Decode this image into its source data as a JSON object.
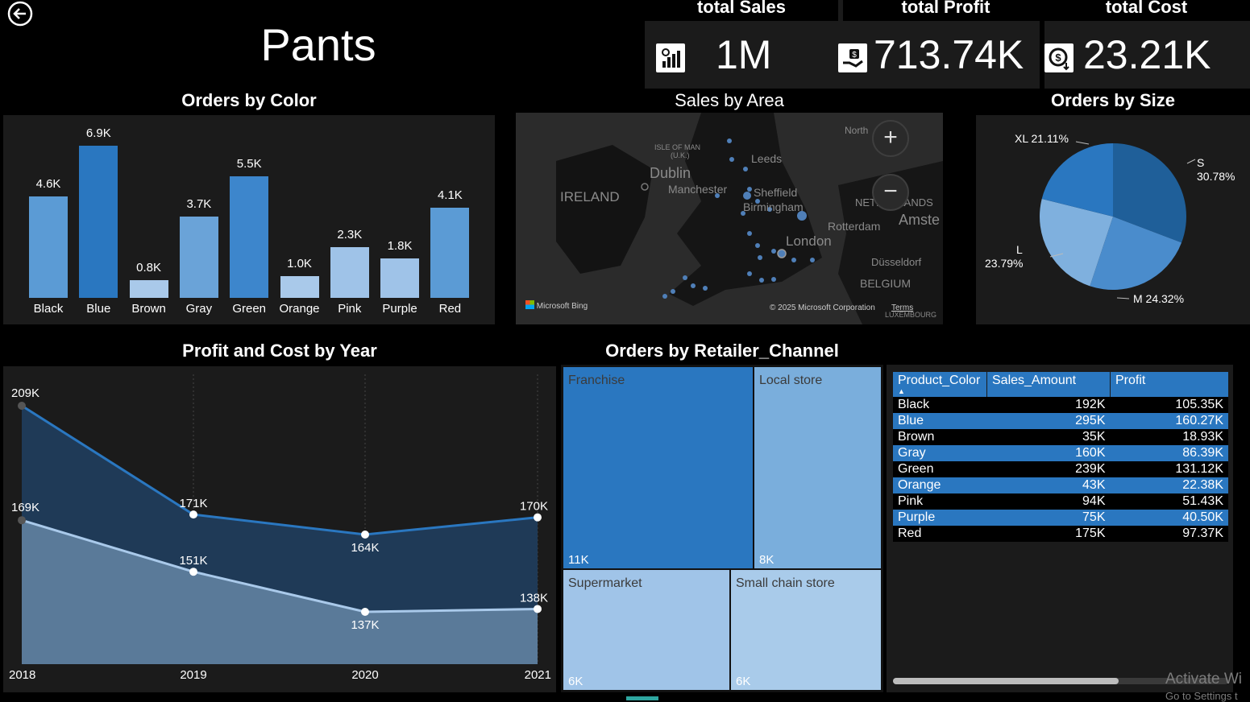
{
  "page": {
    "title": "Pants",
    "back_icon": "back-arrow-icon"
  },
  "kpis": [
    {
      "label": "total Sales",
      "value": "1M",
      "icon": "bar-chart-dollar-icon"
    },
    {
      "label": "total Profit",
      "value": "713.74K",
      "icon": "hand-money-icon"
    },
    {
      "label": "total Cost",
      "value": "23.21K",
      "icon": "dollar-down-icon"
    }
  ],
  "orders_by_color": {
    "title": "Orders by Color",
    "chart_data": {
      "type": "bar",
      "categories": [
        "Black",
        "Blue",
        "Brown",
        "Gray",
        "Green",
        "Orange",
        "Pink",
        "Purple",
        "Red"
      ],
      "values": [
        4.6,
        6.9,
        0.8,
        3.7,
        5.5,
        1.0,
        2.3,
        1.8,
        4.1
      ],
      "value_labels": [
        "4.6K",
        "6.9K",
        "0.8K",
        "3.7K",
        "5.5K",
        "1.0K",
        "2.3K",
        "1.8K",
        "4.1K"
      ],
      "colors": [
        "#5b9bd5",
        "#2a77c0",
        "#a9c9ea",
        "#6aa3d8",
        "#3d86cc",
        "#a9c9ea",
        "#9fc3e8",
        "#9fc3e8",
        "#5b9bd5"
      ],
      "unit": "K"
    }
  },
  "sales_by_area": {
    "title": "Sales by Area",
    "labels": {
      "ireland": "IRELAND",
      "dublin": "Dublin",
      "isle_of_man": "ISLE OF MAN",
      "uk": "(U.K.)",
      "manchester": "Manchester",
      "leeds": "Leeds",
      "sheffield": "Sheffield",
      "birmingham": "Birmingham",
      "london": "London",
      "rotterdam": "Rotterdam",
      "amsterdam": "Amste",
      "netherlands": "NETHERLANDS",
      "dusseldorf": "Düsseldorf",
      "belgium": "BELGIUM",
      "luxembourg": "LUXEMBOURG",
      "north": "North"
    },
    "attribution": "Microsoft Bing",
    "copyright": "© 2025 Microsoft Corporation",
    "terms": "Terms",
    "zoom_in": "+",
    "zoom_out": "−"
  },
  "orders_by_size": {
    "title": "Orders by Size",
    "chart_data": {
      "type": "pie",
      "slices": [
        {
          "label": "S",
          "value": 30.78,
          "color": "#1f5f99"
        },
        {
          "label": "M",
          "value": 24.32,
          "color": "#4a8ccc"
        },
        {
          "label": "L",
          "value": 23.79,
          "color": "#7fb0de"
        },
        {
          "label": "XL",
          "value": 21.11,
          "color": "#2a77c0"
        }
      ]
    },
    "labels": {
      "s_name": "S",
      "s_pct": "30.78%",
      "m": "M 24.32%",
      "l_name": "L",
      "l_pct": "23.79%",
      "xl": "XL 21.11%"
    }
  },
  "profit_cost_by_year": {
    "title": "Profit and Cost by Year",
    "chart_data": {
      "type": "area",
      "x": [
        "2018",
        "2019",
        "2020",
        "2021"
      ],
      "series": [
        {
          "values": [
            209,
            171,
            164,
            170
          ],
          "labels": [
            "209K",
            "171K",
            "164K",
            "170K"
          ],
          "color": "#2a77c0",
          "fill": "#1f3a57"
        },
        {
          "values": [
            169,
            151,
            137,
            138
          ],
          "labels": [
            "169K",
            "151K",
            "137K",
            "138K"
          ],
          "color": "#a9c9ea",
          "fill": "#5a7a99"
        }
      ],
      "ylim": [
        100,
        215
      ]
    }
  },
  "orders_by_channel": {
    "title": "Orders by Retailer_Channel",
    "cells": [
      {
        "name": "Franchise",
        "value": "11K",
        "color": "#2a77c0"
      },
      {
        "name": "Local store",
        "value": "8K",
        "color": "#7aaedc"
      },
      {
        "name": "Supermarket",
        "value": "6K",
        "color": "#a0c4e8"
      },
      {
        "name": "Small chain store",
        "value": "6K",
        "color": "#a9cbea"
      }
    ]
  },
  "table": {
    "headers": [
      "Product_Color",
      "Sales_Amount",
      "Profit"
    ],
    "rows": [
      [
        "Black",
        "192K",
        "105.35K"
      ],
      [
        "Blue",
        "295K",
        "160.27K"
      ],
      [
        "Brown",
        "35K",
        "18.93K"
      ],
      [
        "Gray",
        "160K",
        "86.39K"
      ],
      [
        "Green",
        "239K",
        "131.12K"
      ],
      [
        "Orange",
        "43K",
        "22.38K"
      ],
      [
        "Pink",
        "94K",
        "51.43K"
      ],
      [
        "Purple",
        "75K",
        "40.50K"
      ],
      [
        "Red",
        "175K",
        "97.37K"
      ]
    ]
  },
  "watermark": {
    "line1": "Activate Wi",
    "line2": "Go to Settings t"
  }
}
